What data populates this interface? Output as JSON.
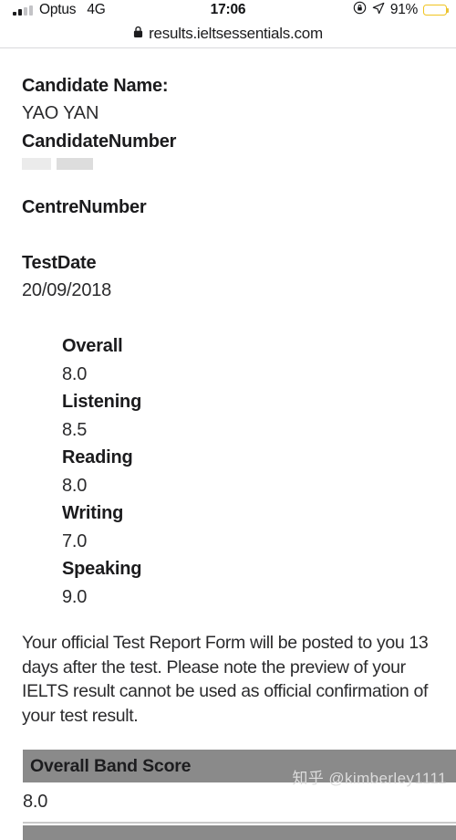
{
  "status_bar": {
    "carrier": "Optus",
    "network": "4G",
    "time": "17:06",
    "battery_percent": "91%",
    "battery_level": 91,
    "battery_color": "#f6c92c",
    "rotation_lock_icon": "rotation-lock-icon",
    "location_icon": "location-arrow-icon",
    "signal_icon": "signal-bars-icon",
    "signal_bars_filled": 2,
    "signal_bars_total": 4
  },
  "browser": {
    "lock_icon": "lock-icon",
    "url": "results.ieltsessentials.com"
  },
  "result": {
    "candidate_name_label": "Candidate Name:",
    "candidate_name_value": "YAO YAN",
    "candidate_number_label": "CandidateNumber",
    "candidate_number_value": "",
    "centre_number_label": "CentreNumber",
    "centre_number_value": "",
    "test_date_label": "TestDate",
    "test_date_value": "20/09/2018",
    "scores": [
      {
        "label": "Overall",
        "value": "8.0"
      },
      {
        "label": "Listening",
        "value": "8.5"
      },
      {
        "label": "Reading",
        "value": "8.0"
      },
      {
        "label": "Writing",
        "value": "7.0"
      },
      {
        "label": "Speaking",
        "value": "9.0"
      }
    ],
    "notice": "Your official Test Report Form will be posted to you 13 days after the test. Please note the preview of your IELTS result cannot be used as official confirmation of your test result.",
    "band_header": "Overall Band Score",
    "band_value": "8.0"
  },
  "watermark": "知乎 @kimberley1111",
  "colors": {
    "band_bar": "#8a8a8a",
    "text": "#2b2b2d",
    "battery_yellow": "#f6c92c"
  }
}
